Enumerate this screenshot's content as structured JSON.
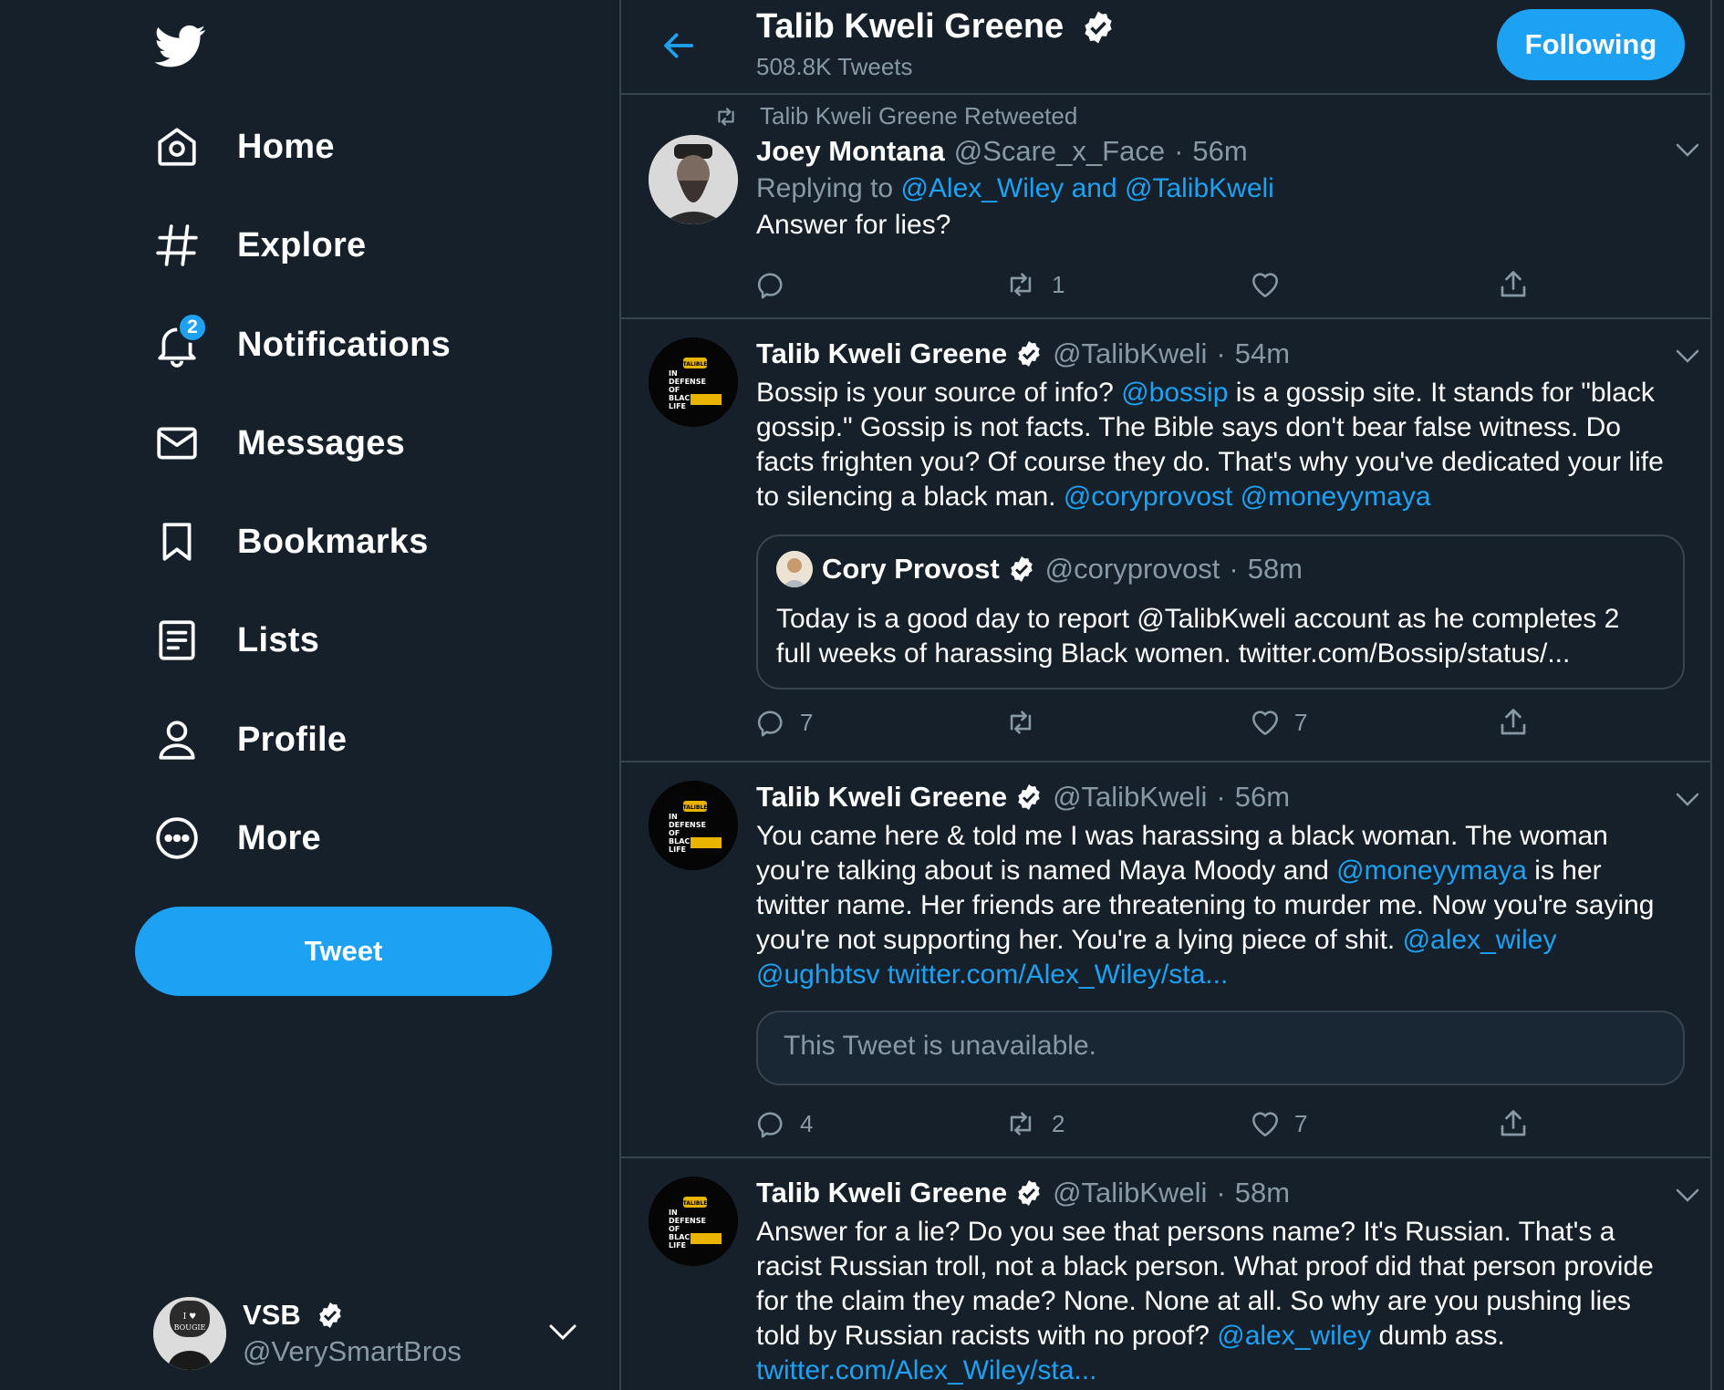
{
  "sidebar": {
    "logo": "twitter-bird-icon",
    "nav": [
      {
        "label": "Home",
        "icon": "home-icon"
      },
      {
        "label": "Explore",
        "icon": "hashtag-icon"
      },
      {
        "label": "Notifications",
        "icon": "bell-icon",
        "badge": "2"
      },
      {
        "label": "Messages",
        "icon": "envelope-icon"
      },
      {
        "label": "Bookmarks",
        "icon": "bookmark-icon"
      },
      {
        "label": "Lists",
        "icon": "list-icon"
      },
      {
        "label": "Profile",
        "icon": "person-icon"
      },
      {
        "label": "More",
        "icon": "more-circle-icon"
      }
    ],
    "tweet_button": "Tweet",
    "account": {
      "name": "VSB",
      "handle": "@VerySmartBros",
      "avatar_text": "I ♥ BOUGIE BLACK GIRLS"
    }
  },
  "header": {
    "name": "Talib Kweli Greene",
    "count": "508.8K Tweets",
    "follow_label": "Following"
  },
  "tweets": [
    {
      "context": "Talib Kweli Greene Retweeted",
      "name": "Joey Montana",
      "handle": "@Scare_x_Face",
      "sep": "·",
      "time": "56m",
      "reply_prefix": "Replying to",
      "reply_to": "@Alex_Wiley and @TalibKweli",
      "text": "Answer for lies?",
      "counts": {
        "reply": "",
        "retweet": "1",
        "like": ""
      }
    },
    {
      "name": "Talib Kweli Greene",
      "handle": "@TalibKweli",
      "sep": "·",
      "time": "54m",
      "text_parts": [
        "Bossip is your source of info? ",
        "@bossip",
        " is a gossip site. It stands for \"black gossip.\" Gossip is not facts. The Bible says don't bear false witness. Do facts frighten you? Of course they do. That's why you've dedicated your life to silencing a black man. ",
        "@coryprovost @moneyymaya"
      ],
      "quote": {
        "name": "Cory Provost",
        "handle": "@coryprovost",
        "sep": "·",
        "time": "58m",
        "text": "Today is a good day to report @TalibKweli account as he completes 2 full weeks of harassing Black women. twitter.com/Bossip/status/..."
      },
      "counts": {
        "reply": "7",
        "retweet": "",
        "like": "7"
      }
    },
    {
      "name": "Talib Kweli Greene",
      "handle": "@TalibKweli",
      "sep": "·",
      "time": "56m",
      "text_parts": [
        "You came here & told me I was harassing a black woman. The woman you're talking about is named Maya Moody and ",
        "@moneyymaya",
        " is her twitter name. Her friends are threatening to murder me. Now you're saying you're not supporting her. You're a lying piece of shit. ",
        "@alex_wiley @ughbtsv twitter.com/Alex_Wiley/sta..."
      ],
      "unavailable": "This Tweet is unavailable.",
      "counts": {
        "reply": "4",
        "retweet": "2",
        "like": "7"
      }
    },
    {
      "name": "Talib Kweli Greene",
      "handle": "@TalibKweli",
      "sep": "·",
      "time": "58m",
      "text_parts": [
        "Answer for a lie? Do you see that persons name? It's Russian. That's a racist Russian troll, not a black person. What proof did that person provide for the claim they made? None. None at all. So why are you pushing lies told by Russian racists with no proof? ",
        "@alex_wiley",
        " dumb ass.",
        "twitter.com/Alex_Wiley/sta..."
      ]
    }
  ],
  "avatar_text": {
    "line1": "IN",
    "line2": "DEFENSE",
    "line3": "OF",
    "line4": "BLACK",
    "line5": "LIFE",
    "tag": "TALIBLE"
  },
  "colors": {
    "background": "#15202b",
    "accent": "#1da1f2",
    "muted": "#8899a6",
    "border": "#38444d"
  }
}
